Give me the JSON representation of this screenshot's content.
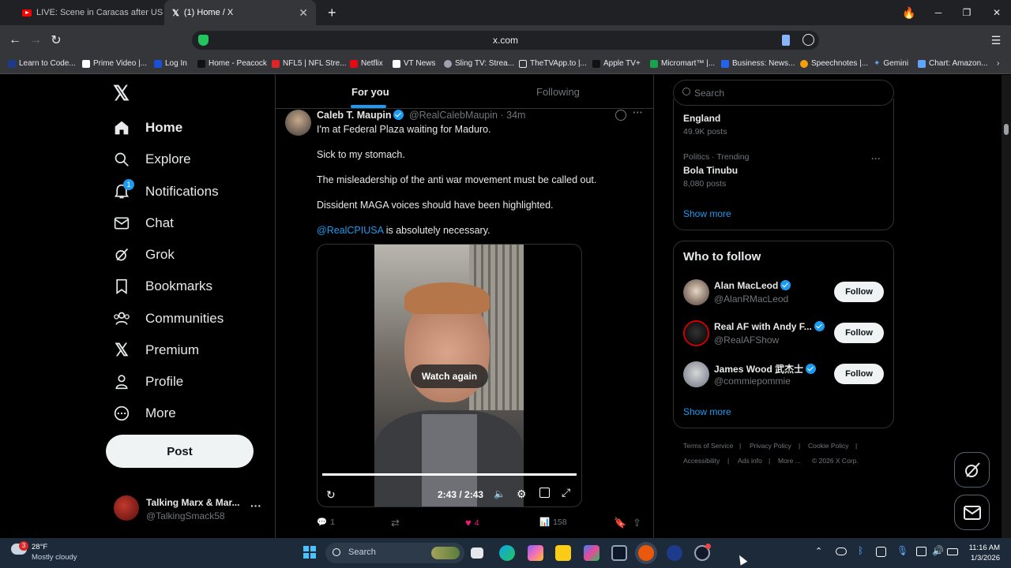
{
  "browser": {
    "tabs": [
      {
        "label": "LIVE: Scene in Caracas after US stri",
        "active": false
      },
      {
        "label": "(1) Home / X",
        "active": true
      }
    ],
    "url": "x.com",
    "bookmarks": [
      "Learn to Code...",
      "Prime Video |...",
      "Log In",
      "Home - Peacock",
      "NFL5 | NFL Stre...",
      "Netflix",
      "VT News",
      "Sling TV: Strea...",
      "TheTVApp.to |...",
      "Apple TV+",
      "Micromart™ |...",
      "Business: News...",
      "Speechnotes |...",
      "Gemini",
      "Chart: Amazon..."
    ]
  },
  "nav": {
    "items": [
      {
        "label": "Home",
        "icon": "home-icon"
      },
      {
        "label": "Explore",
        "icon": "search-icon"
      },
      {
        "label": "Notifications",
        "icon": "bell-icon",
        "badge": "1"
      },
      {
        "label": "Chat",
        "icon": "mail-icon"
      },
      {
        "label": "Grok",
        "icon": "grok-icon"
      },
      {
        "label": "Bookmarks",
        "icon": "bookmark-icon"
      },
      {
        "label": "Communities",
        "icon": "people-icon"
      },
      {
        "label": "Premium",
        "icon": "x-logo-icon"
      },
      {
        "label": "Profile",
        "icon": "person-icon"
      },
      {
        "label": "More",
        "icon": "more-circle-icon"
      }
    ],
    "post_label": "Post",
    "account": {
      "name": "Talking Marx & Mar...",
      "handle": "@TalkingSmack58"
    }
  },
  "feed": {
    "tabs": [
      "For you",
      "Following"
    ],
    "tweet": {
      "author": "Caleb T. Maupin",
      "handle": "@RealCalebMaupin",
      "time": "· 34m",
      "lines": [
        "I'm at Federal Plaza waiting for Maduro.",
        "Sick to my stomach.",
        "The misleadership of the anti war movement must be called out.",
        "Dissident MAGA voices should have been highlighted."
      ],
      "mention": "@RealCPIUSA",
      "mention_suffix": " is absolutely necessary.",
      "video": {
        "watch_again": "Watch again",
        "time": "2:43 / 2:43",
        "progress": 1.0
      },
      "stats": {
        "replies": "1",
        "likes": "4",
        "views": "158"
      }
    }
  },
  "right": {
    "search_placeholder": "Search",
    "trends": [
      {
        "meta": "",
        "name": "England",
        "posts": "49.9K posts"
      },
      {
        "meta": "Politics · Trending",
        "name": "Bola Tinubu",
        "posts": "8,080 posts"
      }
    ],
    "show_more": "Show more",
    "who_to_follow_title": "Who to follow",
    "who_to_follow": [
      {
        "name": "Alan MacLeod",
        "handle": "@AlanRMacLeod"
      },
      {
        "name": "Real AF with Andy F...",
        "handle": "@RealAFShow"
      },
      {
        "name": "James Wood 武杰士",
        "handle": "@commiepommie"
      }
    ],
    "follow_label": "Follow",
    "footer": [
      "Terms of Service",
      "Privacy Policy",
      "Cookie Policy",
      "Accessibility",
      "Ads info",
      "More ...",
      "© 2026 X Corp."
    ]
  },
  "taskbar": {
    "weather_temp": "28°F",
    "weather_desc": "Mostly cloudy",
    "weather_badge": "3",
    "search_placeholder": "Search",
    "time": "11:16 AM",
    "date": "1/3/2026"
  }
}
